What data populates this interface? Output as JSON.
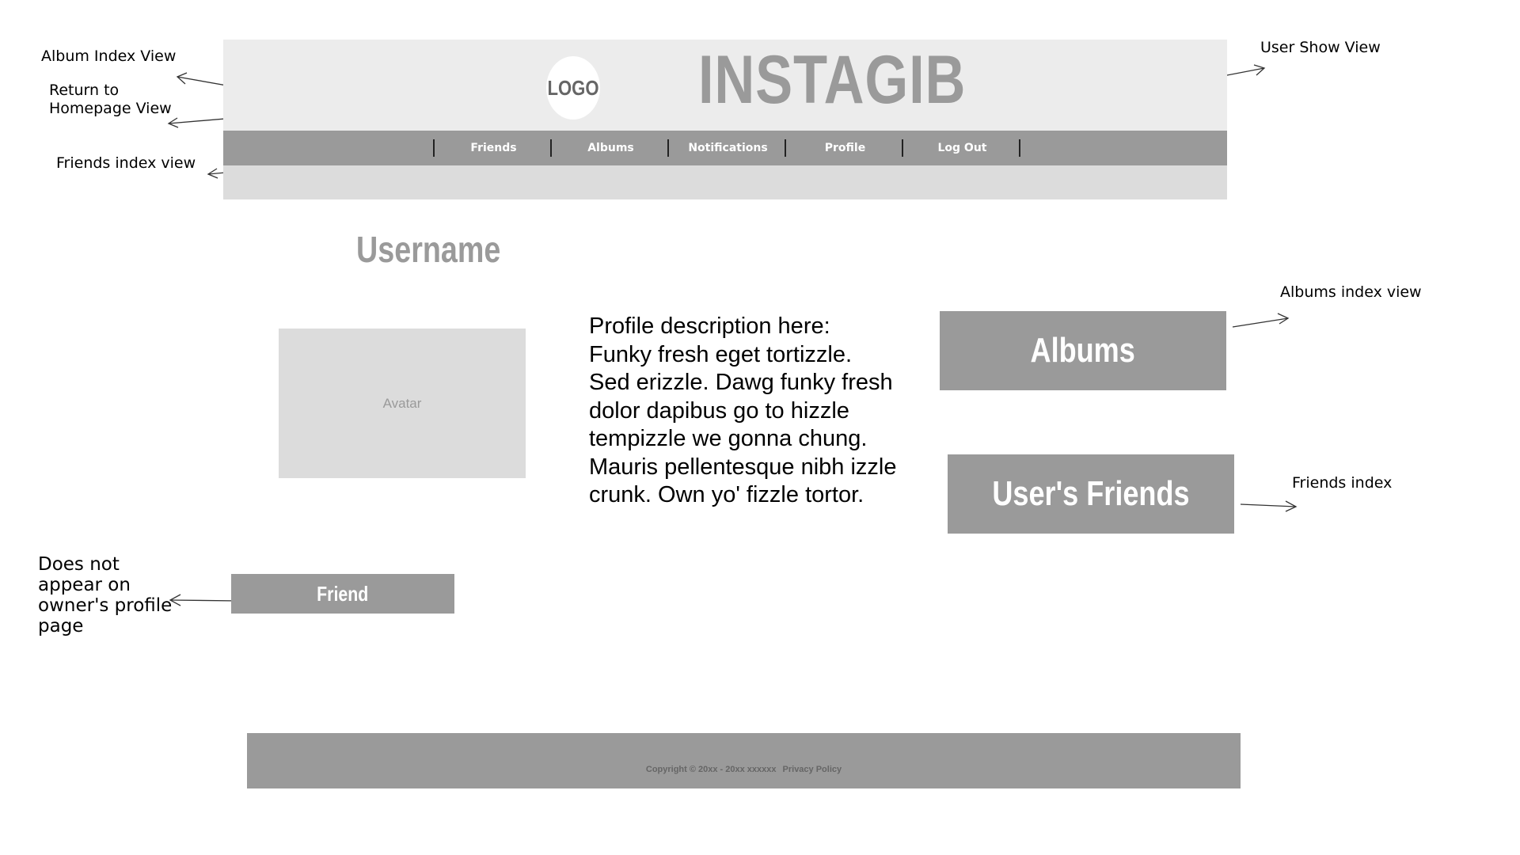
{
  "header": {
    "logo_text": "LOGO",
    "brand": "INSTAGIB",
    "nav": [
      {
        "label": "Friends"
      },
      {
        "label": "Albums"
      },
      {
        "label": "Notifications"
      },
      {
        "label": "Profile"
      },
      {
        "label": "Log Out"
      }
    ]
  },
  "profile": {
    "username": "Username",
    "avatar_label": "Avatar",
    "description": "Profile description here: Funky fresh eget tortizzle. Sed erizzle. Dawg funky fresh dolor dapibus go to hizzle tempizzle we gonna chung. Mauris pellentesque nibh izzle crunk. Own yo' fizzle tortor.",
    "albums_label": "Albums",
    "friends_label": "User's Friends",
    "friend_button": "Friend"
  },
  "footer": {
    "copyright": "Copyright © 20xx - 20xx xxxxxx",
    "privacy": "Privacy Policy"
  },
  "annotations": {
    "album_index": "Album Index View",
    "return_home": "Return to\nHomepage View",
    "friends_index_view": "Friends index view",
    "user_show": "User Show View",
    "albums_index_view": "Albums index view",
    "friends_index": "Friends index",
    "not_owner": "Does not\nappear on\nowner's profile\npage"
  }
}
